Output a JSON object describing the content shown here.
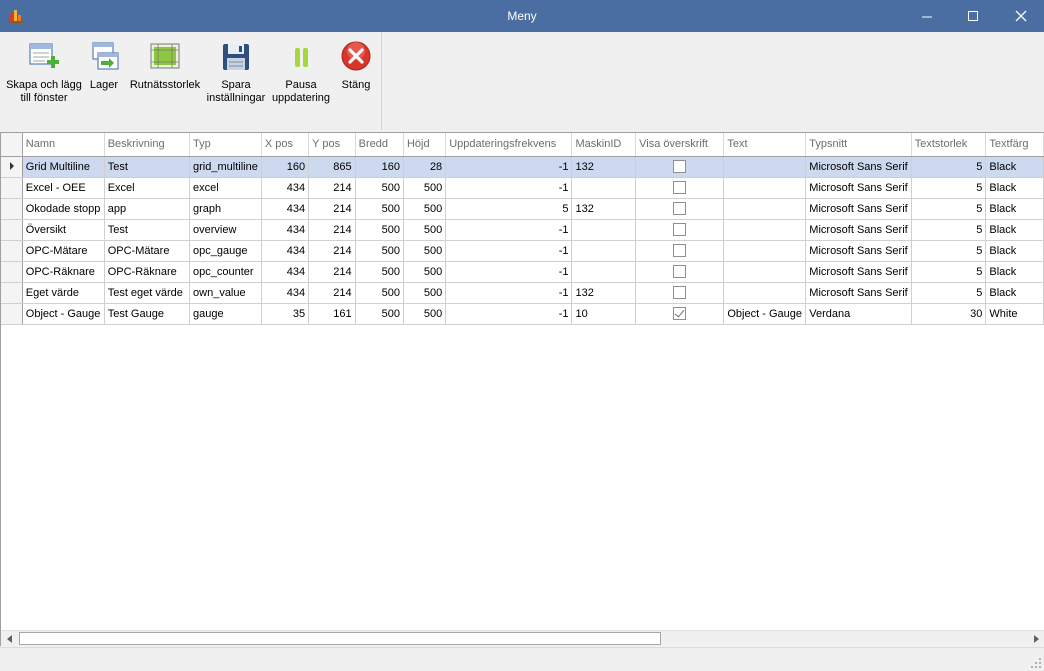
{
  "window": {
    "title": "Meny"
  },
  "toolbar": {
    "items": [
      {
        "label": "Skapa och lägg\ntill fönster",
        "icon": "add-window-icon"
      },
      {
        "label": "Lager",
        "icon": "layers-icon"
      },
      {
        "label": "Rutnätsstorlek",
        "icon": "grid-size-icon"
      },
      {
        "label": "Spara\ninställningar",
        "icon": "save-icon"
      },
      {
        "label": "Pausa\nuppdatering",
        "icon": "pause-icon"
      },
      {
        "label": "Stäng",
        "icon": "close-icon"
      }
    ]
  },
  "grid": {
    "columns": [
      "Namn",
      "Beskrivning",
      "Typ",
      "X pos",
      "Y pos",
      "Bredd",
      "Höjd",
      "Uppdateringsfrekvens",
      "MaskinID",
      "Visa överskrift",
      "Text",
      "Typsnitt",
      "Textstorlek",
      "Textfärg"
    ],
    "rows": [
      {
        "namn": "Grid Multiline",
        "beskrivning": "Test",
        "typ": "grid_multiline",
        "xpos": "160",
        "ypos": "865",
        "bredd": "160",
        "hojd": "28",
        "freq": "-1",
        "maskinid": "132",
        "visa": false,
        "text": "",
        "typsnitt": "Microsoft Sans Serif",
        "textstorlek": "5",
        "textfarg": "Black"
      },
      {
        "namn": "Excel - OEE",
        "beskrivning": "Excel",
        "typ": "excel",
        "xpos": "434",
        "ypos": "214",
        "bredd": "500",
        "hojd": "500",
        "freq": "-1",
        "maskinid": "",
        "visa": false,
        "text": "",
        "typsnitt": "Microsoft Sans Serif",
        "textstorlek": "5",
        "textfarg": "Black"
      },
      {
        "namn": "Okodade stopp",
        "beskrivning": "app",
        "typ": "graph",
        "xpos": "434",
        "ypos": "214",
        "bredd": "500",
        "hojd": "500",
        "freq": "5",
        "maskinid": "132",
        "visa": false,
        "text": "",
        "typsnitt": "Microsoft Sans Serif",
        "textstorlek": "5",
        "textfarg": "Black"
      },
      {
        "namn": "Översikt",
        "beskrivning": "Test",
        "typ": "overview",
        "xpos": "434",
        "ypos": "214",
        "bredd": "500",
        "hojd": "500",
        "freq": "-1",
        "maskinid": "",
        "visa": false,
        "text": "",
        "typsnitt": "Microsoft Sans Serif",
        "textstorlek": "5",
        "textfarg": "Black"
      },
      {
        "namn": "OPC-Mätare",
        "beskrivning": "OPC-Mätare",
        "typ": "opc_gauge",
        "xpos": "434",
        "ypos": "214",
        "bredd": "500",
        "hojd": "500",
        "freq": "-1",
        "maskinid": "",
        "visa": false,
        "text": "",
        "typsnitt": "Microsoft Sans Serif",
        "textstorlek": "5",
        "textfarg": "Black"
      },
      {
        "namn": "OPC-Räknare",
        "beskrivning": "OPC-Räknare",
        "typ": "opc_counter",
        "xpos": "434",
        "ypos": "214",
        "bredd": "500",
        "hojd": "500",
        "freq": "-1",
        "maskinid": "",
        "visa": false,
        "text": "",
        "typsnitt": "Microsoft Sans Serif",
        "textstorlek": "5",
        "textfarg": "Black"
      },
      {
        "namn": "Eget värde",
        "beskrivning": "Test eget värde",
        "typ": "own_value",
        "xpos": "434",
        "ypos": "214",
        "bredd": "500",
        "hojd": "500",
        "freq": "-1",
        "maskinid": "132",
        "visa": false,
        "text": "",
        "typsnitt": "Microsoft Sans Serif",
        "textstorlek": "5",
        "textfarg": "Black"
      },
      {
        "namn": "Object - Gauge",
        "beskrivning": "Test Gauge",
        "typ": "gauge",
        "xpos": "35",
        "ypos": "161",
        "bredd": "500",
        "hojd": "500",
        "freq": "-1",
        "maskinid": "10",
        "visa": true,
        "text": "Object - Gauge",
        "typsnitt": "Verdana",
        "textstorlek": "30",
        "textfarg": "White"
      }
    ],
    "selected_row": 0
  },
  "colors": {
    "titlebar": "#4a6ea1",
    "selection": "#cdd9ef"
  }
}
